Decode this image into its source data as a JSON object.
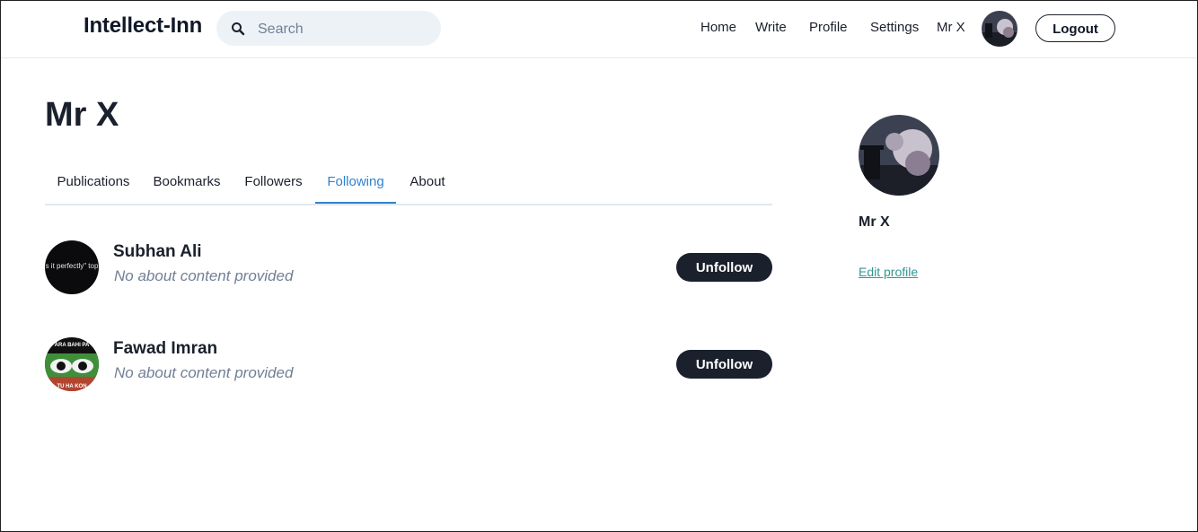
{
  "header": {
    "brand": "Intellect-Inn",
    "search_placeholder": "Search",
    "nav": [
      "Home",
      "Write",
      "Profile",
      "Settings",
      "Mr X"
    ],
    "logout_label": "Logout"
  },
  "profile": {
    "name": "Mr X",
    "tabs": [
      "Publications",
      "Bookmarks",
      "Followers",
      "Following",
      "About"
    ],
    "active_tab": "Following"
  },
  "following": [
    {
      "name": "Subhan Ali",
      "about": "No about content provided",
      "button": "Unfollow",
      "avatar_text": "s it perfectly\" top"
    },
    {
      "name": "Fawad Imran",
      "about": "No about content provided",
      "button": "Unfollow",
      "avatar_text_top": "ARA BAHI PA",
      "avatar_text_bottom": "TU HA KON"
    }
  ],
  "sidebar": {
    "name": "Mr X",
    "edit_label": "Edit profile"
  },
  "colors": {
    "accent": "#3182ce",
    "link": "#319795",
    "button_dark": "#1a202c",
    "search_bg": "#edf2f7"
  },
  "icons": {
    "search": "search-icon"
  }
}
